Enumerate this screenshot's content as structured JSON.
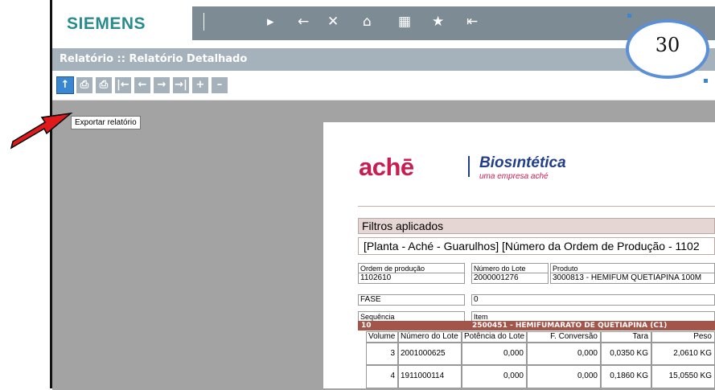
{
  "app": {
    "brand": "SIEMENS"
  },
  "nav": {
    "icons": [
      "play-icon",
      "back-arrow-icon",
      "close-icon",
      "home-icon",
      "list-icon",
      "star-icon",
      "exit-icon"
    ]
  },
  "window": {
    "title": "Relatório :: Relatório Detalhado"
  },
  "toolbar": {
    "tooltip": "Exportar relatório",
    "buttons": [
      "export-icon",
      "print-icon",
      "print-preview-icon",
      "first-page-icon",
      "prev-page-icon",
      "next-page-icon",
      "last-page-icon",
      "zoom-in-icon",
      "zoom-out-icon"
    ]
  },
  "badge": {
    "number": "30"
  },
  "report": {
    "logo": {
      "ache": "achē",
      "bio": "Biosıntética",
      "bio_sub": "uma empresa aché"
    },
    "filters": {
      "title": "Filtros aplicados",
      "value": "[Planta - Aché - Guarulhos] [Número da Ordem de Produção - 1102"
    },
    "order": {
      "labels": [
        "Ordem de produção",
        "Número do Lote",
        "Produto"
      ],
      "values": [
        "1102610",
        "2000001276",
        "3000813 - HEMIFUM QUETIAPINA 100M"
      ]
    },
    "fase": {
      "label": "FASE",
      "value": "0"
    },
    "sequence": {
      "labels": [
        "Sequência",
        "Item"
      ],
      "values": [
        "10",
        "2500451 - HEMIFUMARATO DE QUETIAPINA (C1)"
      ]
    },
    "table": {
      "headers": [
        "Volume",
        "Número do Lote",
        "Potência do Lote",
        "F. Conversão",
        "Tara",
        "Peso"
      ],
      "rows": [
        [
          "3",
          "2001000625",
          "0,000",
          "0,000",
          "0,0350 KG",
          "2,0610 KG"
        ],
        [
          "4",
          "1911000114",
          "0,000",
          "0,000",
          "0,1860 KG",
          "15,0550 KG"
        ]
      ]
    }
  }
}
